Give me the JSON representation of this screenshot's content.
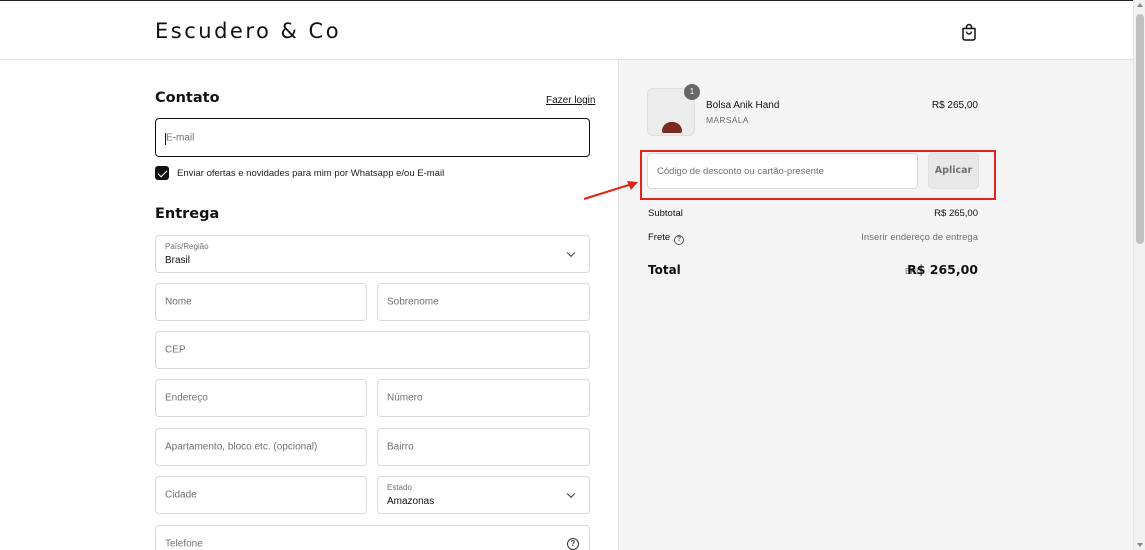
{
  "header": {
    "brand": "Escudero & Co"
  },
  "contact": {
    "title": "Contato",
    "login_link": "Fazer login",
    "email_placeholder": "E-mail",
    "offers_label": "Enviar ofertas e novidades para mim por Whatsapp e/ou E-mail"
  },
  "delivery": {
    "title": "Entrega",
    "country_label": "País/Região",
    "country_value": "Brasil",
    "first_name": "Nome",
    "last_name": "Sobrenome",
    "cep": "CEP",
    "address": "Endereço",
    "number": "Número",
    "apartment": "Apartamento, bloco etc. (opcional)",
    "neighborhood": "Bairro",
    "city": "Cidade",
    "state_label": "Estado",
    "state_value": "Amazonas",
    "phone": "Telefone",
    "help_glyph": "?"
  },
  "summary": {
    "product": {
      "qty": "1",
      "name": "Bolsa Anik Hand",
      "variant": "MARSALA",
      "price": "R$ 265,00"
    },
    "discount_placeholder": "Código de desconto ou cartão-presente",
    "apply_label": "Aplicar",
    "subtotal_label": "Subtotal",
    "subtotal_value": "R$ 265,00",
    "shipping_label": "Frete",
    "shipping_value": "Inserir endereço de entrega",
    "help_glyph": "?",
    "total_label": "Total",
    "total_currency": "BRL",
    "total_value": "R$ 265,00"
  },
  "annotation": {
    "highlight_color": "#e2231a"
  },
  "icons": [
    "shopping-bag-icon",
    "chevron-down-icon",
    "help-icon",
    "checkmark-icon"
  ]
}
